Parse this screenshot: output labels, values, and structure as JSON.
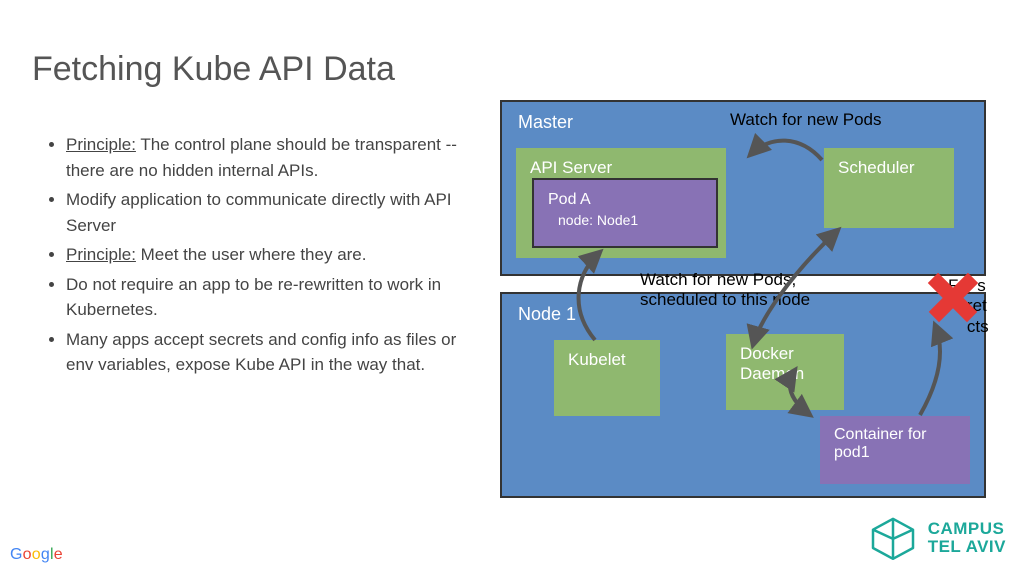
{
  "title": "Fetching Kube API Data",
  "bullets": [
    {
      "principle": "Principle:",
      "text": " The control plane should be transparent -- there are no hidden internal APIs."
    },
    {
      "principle": "",
      "text": "Modify application to communicate directly with API Server"
    },
    {
      "principle": "Principle:",
      "text": " Meet the user where they are."
    },
    {
      "principle": "",
      "text": "Do not require an app to be re-rewritten to work in Kubernetes."
    },
    {
      "principle": "",
      "text": "Many apps accept secrets and config info as files or env variables, expose Kube API in the way that."
    }
  ],
  "diagram": {
    "master": {
      "title": "Master",
      "api_server": "API Server",
      "scheduler": "Scheduler",
      "pod": {
        "name": "Pod A",
        "node": "node: Node1"
      }
    },
    "node1": {
      "title": "Node 1",
      "kubelet": "Kubelet",
      "docker": "Docker Daemon",
      "container": "Container for pod1"
    },
    "annot_watch_new": "Watch for new Pods",
    "annot_watch_sched": "Watch for new Pods, scheduled to this node",
    "hidden1": "F",
    "hidden2": "s",
    "hidden3": "ret",
    "hidden4": "cts"
  },
  "footer": {
    "google": {
      "G": "G",
      "o1": "o",
      "o2": "o",
      "g": "g",
      "l": "l",
      "e": "e"
    },
    "campus1": "CAMPUS",
    "campus2": "TEL AVIV"
  }
}
